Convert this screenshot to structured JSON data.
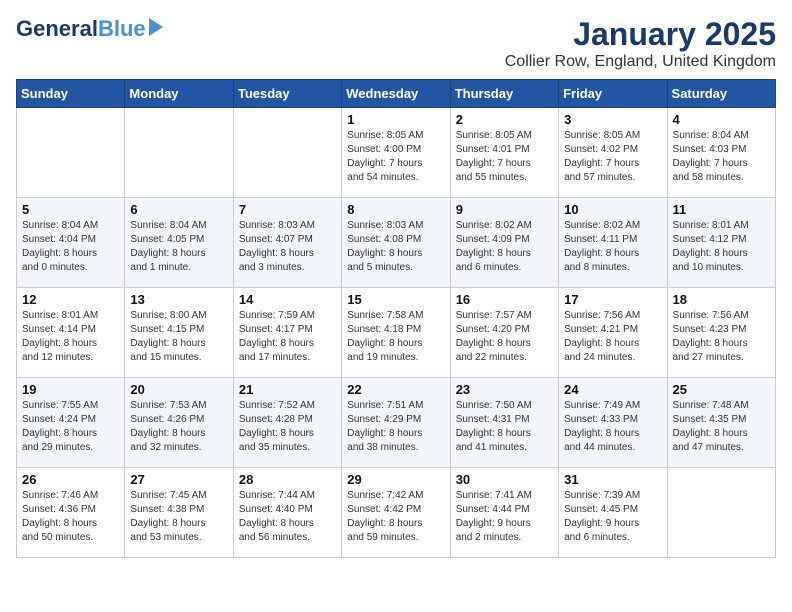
{
  "header": {
    "logo_general": "General",
    "logo_blue": "Blue",
    "title": "January 2025",
    "subtitle": "Collier Row, England, United Kingdom"
  },
  "days_of_week": [
    "Sunday",
    "Monday",
    "Tuesday",
    "Wednesday",
    "Thursday",
    "Friday",
    "Saturday"
  ],
  "weeks": [
    {
      "cells": [
        {
          "day": "",
          "info": ""
        },
        {
          "day": "",
          "info": ""
        },
        {
          "day": "",
          "info": ""
        },
        {
          "day": "1",
          "info": "Sunrise: 8:05 AM\nSunset: 4:00 PM\nDaylight: 7 hours\nand 54 minutes."
        },
        {
          "day": "2",
          "info": "Sunrise: 8:05 AM\nSunset: 4:01 PM\nDaylight: 7 hours\nand 55 minutes."
        },
        {
          "day": "3",
          "info": "Sunrise: 8:05 AM\nSunset: 4:02 PM\nDaylight: 7 hours\nand 57 minutes."
        },
        {
          "day": "4",
          "info": "Sunrise: 8:04 AM\nSunset: 4:03 PM\nDaylight: 7 hours\nand 58 minutes."
        }
      ]
    },
    {
      "cells": [
        {
          "day": "5",
          "info": "Sunrise: 8:04 AM\nSunset: 4:04 PM\nDaylight: 8 hours\nand 0 minutes."
        },
        {
          "day": "6",
          "info": "Sunrise: 8:04 AM\nSunset: 4:05 PM\nDaylight: 8 hours\nand 1 minute."
        },
        {
          "day": "7",
          "info": "Sunrise: 8:03 AM\nSunset: 4:07 PM\nDaylight: 8 hours\nand 3 minutes."
        },
        {
          "day": "8",
          "info": "Sunrise: 8:03 AM\nSunset: 4:08 PM\nDaylight: 8 hours\nand 5 minutes."
        },
        {
          "day": "9",
          "info": "Sunrise: 8:02 AM\nSunset: 4:09 PM\nDaylight: 8 hours\nand 6 minutes."
        },
        {
          "day": "10",
          "info": "Sunrise: 8:02 AM\nSunset: 4:11 PM\nDaylight: 8 hours\nand 8 minutes."
        },
        {
          "day": "11",
          "info": "Sunrise: 8:01 AM\nSunset: 4:12 PM\nDaylight: 8 hours\nand 10 minutes."
        }
      ]
    },
    {
      "cells": [
        {
          "day": "12",
          "info": "Sunrise: 8:01 AM\nSunset: 4:14 PM\nDaylight: 8 hours\nand 12 minutes."
        },
        {
          "day": "13",
          "info": "Sunrise: 8:00 AM\nSunset: 4:15 PM\nDaylight: 8 hours\nand 15 minutes."
        },
        {
          "day": "14",
          "info": "Sunrise: 7:59 AM\nSunset: 4:17 PM\nDaylight: 8 hours\nand 17 minutes."
        },
        {
          "day": "15",
          "info": "Sunrise: 7:58 AM\nSunset: 4:18 PM\nDaylight: 8 hours\nand 19 minutes."
        },
        {
          "day": "16",
          "info": "Sunrise: 7:57 AM\nSunset: 4:20 PM\nDaylight: 8 hours\nand 22 minutes."
        },
        {
          "day": "17",
          "info": "Sunrise: 7:56 AM\nSunset: 4:21 PM\nDaylight: 8 hours\nand 24 minutes."
        },
        {
          "day": "18",
          "info": "Sunrise: 7:56 AM\nSunset: 4:23 PM\nDaylight: 8 hours\nand 27 minutes."
        }
      ]
    },
    {
      "cells": [
        {
          "day": "19",
          "info": "Sunrise: 7:55 AM\nSunset: 4:24 PM\nDaylight: 8 hours\nand 29 minutes."
        },
        {
          "day": "20",
          "info": "Sunrise: 7:53 AM\nSunset: 4:26 PM\nDaylight: 8 hours\nand 32 minutes."
        },
        {
          "day": "21",
          "info": "Sunrise: 7:52 AM\nSunset: 4:28 PM\nDaylight: 8 hours\nand 35 minutes."
        },
        {
          "day": "22",
          "info": "Sunrise: 7:51 AM\nSunset: 4:29 PM\nDaylight: 8 hours\nand 38 minutes."
        },
        {
          "day": "23",
          "info": "Sunrise: 7:50 AM\nSunset: 4:31 PM\nDaylight: 8 hours\nand 41 minutes."
        },
        {
          "day": "24",
          "info": "Sunrise: 7:49 AM\nSunset: 4:33 PM\nDaylight: 8 hours\nand 44 minutes."
        },
        {
          "day": "25",
          "info": "Sunrise: 7:48 AM\nSunset: 4:35 PM\nDaylight: 8 hours\nand 47 minutes."
        }
      ]
    },
    {
      "cells": [
        {
          "day": "26",
          "info": "Sunrise: 7:46 AM\nSunset: 4:36 PM\nDaylight: 8 hours\nand 50 minutes."
        },
        {
          "day": "27",
          "info": "Sunrise: 7:45 AM\nSunset: 4:38 PM\nDaylight: 8 hours\nand 53 minutes."
        },
        {
          "day": "28",
          "info": "Sunrise: 7:44 AM\nSunset: 4:40 PM\nDaylight: 8 hours\nand 56 minutes."
        },
        {
          "day": "29",
          "info": "Sunrise: 7:42 AM\nSunset: 4:42 PM\nDaylight: 8 hours\nand 59 minutes."
        },
        {
          "day": "30",
          "info": "Sunrise: 7:41 AM\nSunset: 4:44 PM\nDaylight: 9 hours\nand 2 minutes."
        },
        {
          "day": "31",
          "info": "Sunrise: 7:39 AM\nSunset: 4:45 PM\nDaylight: 9 hours\nand 6 minutes."
        },
        {
          "day": "",
          "info": ""
        }
      ]
    }
  ]
}
